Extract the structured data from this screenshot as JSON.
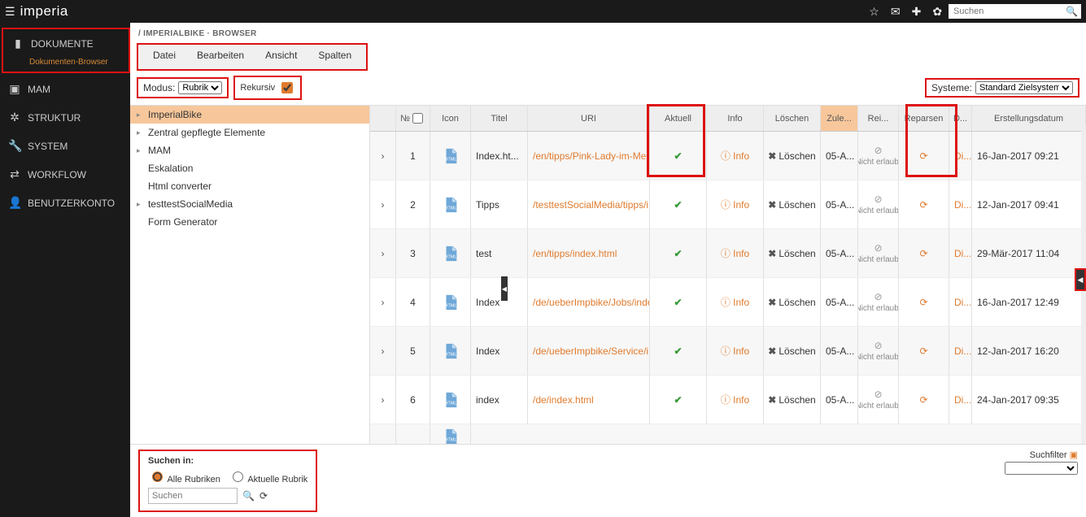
{
  "topbar": {
    "logo": "imperia",
    "search_placeholder": "Suchen"
  },
  "sidebar": {
    "items": [
      {
        "icon": "document-icon",
        "label": "DOKUMENTE",
        "sub": "Dokumenten-Browser",
        "active": true
      },
      {
        "icon": "image-icon",
        "label": "MAM"
      },
      {
        "icon": "gears-icon",
        "label": "STRUKTUR"
      },
      {
        "icon": "wrench-icon",
        "label": "SYSTEM"
      },
      {
        "icon": "workflow-icon",
        "label": "WORKFLOW"
      },
      {
        "icon": "user-icon",
        "label": "BENUTZERKONTO"
      }
    ]
  },
  "breadcrumb": "/ IMPERIALBIKE · BROWSER",
  "menu": {
    "items": [
      "Datei",
      "Bearbeiten",
      "Ansicht",
      "Spalten"
    ]
  },
  "modebar": {
    "modus_label": "Modus:",
    "modus_value": "Rubrik",
    "rekursiv_label": "Rekursiv",
    "rekursiv_checked": true,
    "systeme_label": "Systeme:",
    "systeme_value": "Standard Zielsystem"
  },
  "tree": {
    "items": [
      "ImperialBike",
      "Zentral gepflegte Elemente",
      "MAM",
      "Eskalation",
      "Html converter",
      "testtestSocialMedia",
      "Form Generator"
    ],
    "selected": 0
  },
  "columns": {
    "num": "№",
    "icon": "Icon",
    "titel": "Titel",
    "uri": "URI",
    "aktuell": "Aktuell",
    "info": "Info",
    "loeschen": "Löschen",
    "zul": "Zule...",
    "rei": "Rei...",
    "reparsen": "Reparsen",
    "d": "D...",
    "erst": "Erstellungsdatum"
  },
  "rows": [
    {
      "num": "1",
      "titel": "Index.ht...",
      "uri": "/en/tipps/Pink-Lady-im-Meg...",
      "aktuell": true,
      "info": "Info",
      "loeschen": "Löschen",
      "zul": "05-A...",
      "rei": "Nicht erlaubt",
      "di": "Di...",
      "erst": "16-Jan-2017 09:21"
    },
    {
      "num": "2",
      "titel": "Tipps",
      "uri": "/testtestSocialMedia/tipps/i...",
      "aktuell": true,
      "info": "Info",
      "loeschen": "Löschen",
      "zul": "05-A...",
      "rei": "Nicht erlaubt",
      "di": "Di...",
      "erst": "12-Jan-2017 09:41"
    },
    {
      "num": "3",
      "titel": "test",
      "uri": "/en/tipps/index.html",
      "aktuell": true,
      "info": "Info",
      "loeschen": "Löschen",
      "zul": "05-A...",
      "rei": "Nicht erlaubt",
      "di": "Di...",
      "erst": "29-Mär-2017 11:04"
    },
    {
      "num": "4",
      "titel": "Index",
      "uri": "/de/ueberImpbike/Jobs/inde...",
      "aktuell": true,
      "info": "Info",
      "loeschen": "Löschen",
      "zul": "05-A...",
      "rei": "Nicht erlaubt",
      "di": "Di...",
      "erst": "16-Jan-2017 12:49"
    },
    {
      "num": "5",
      "titel": "Index",
      "uri": "/de/ueberImpbike/Service/i...",
      "aktuell": true,
      "info": "Info",
      "loeschen": "Löschen",
      "zul": "05-A...",
      "rei": "Nicht erlaubt",
      "di": "Di...",
      "erst": "12-Jan-2017 16:20"
    },
    {
      "num": "6",
      "titel": "index",
      "uri": "/de/index.html",
      "aktuell": true,
      "info": "Info",
      "loeschen": "Löschen",
      "zul": "05-A...",
      "rei": "Nicht erlaubt",
      "di": "Di...",
      "erst": "24-Jan-2017 09:35"
    }
  ],
  "bottom": {
    "suchen_in": "Suchen in:",
    "alle": "Alle Rubriken",
    "aktuelle": "Aktuelle Rubrik",
    "search_placeholder": "Suchen",
    "suchfilter": "Suchfilter"
  }
}
